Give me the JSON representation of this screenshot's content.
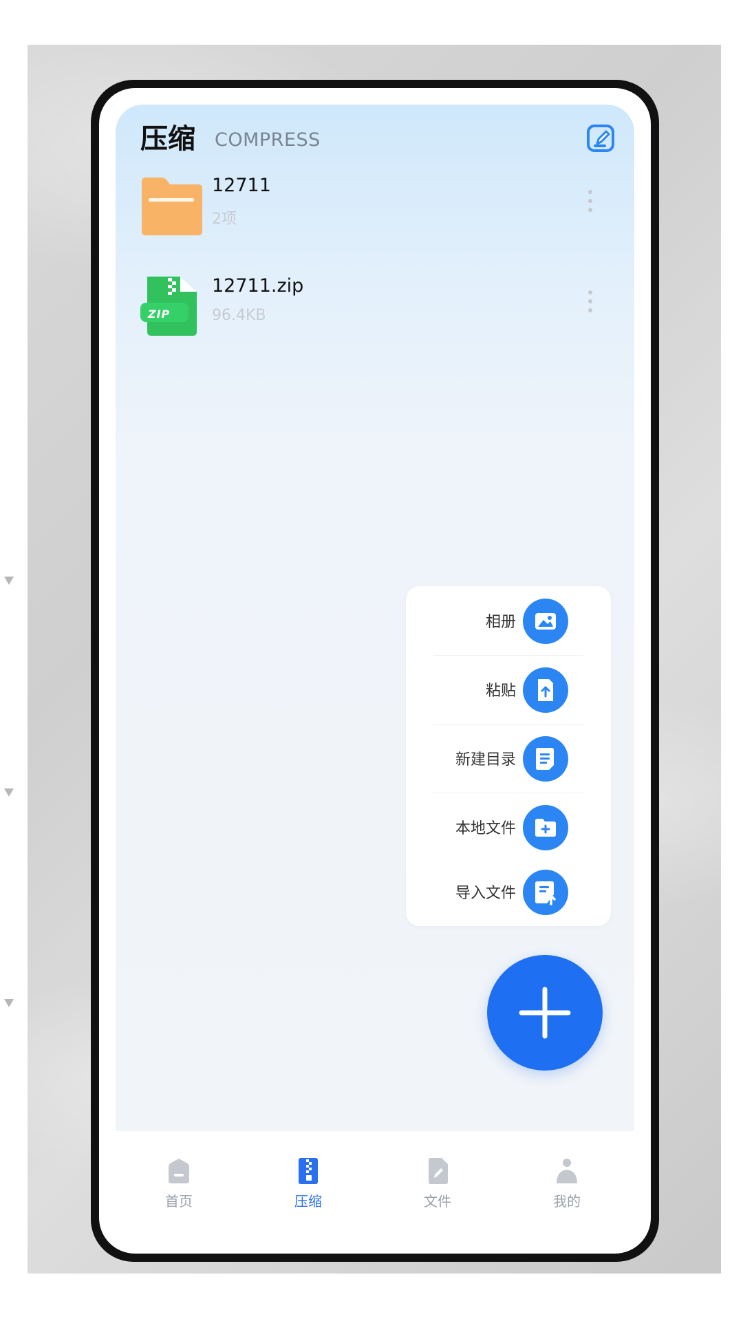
{
  "colors": {
    "accent": "#1f6ff2",
    "menu_icon_bg": "#2b86f4",
    "folder": "#f8b366",
    "zip": "#31c15d",
    "text_muted": "#9aa1aa"
  },
  "header": {
    "title": "压缩",
    "subtitle": "COMPRESS",
    "edit_icon": "edit-icon"
  },
  "files": [
    {
      "name": "12711",
      "meta": "2项",
      "type": "folder",
      "icon": "folder-icon"
    },
    {
      "name": "12711.zip",
      "meta": "96.4KB",
      "type": "zip",
      "icon": "zip-file-icon",
      "badge": "ZIP"
    }
  ],
  "menu": {
    "items": [
      {
        "label": "相册",
        "icon": "album-icon"
      },
      {
        "label": "粘贴",
        "icon": "paste-icon"
      },
      {
        "label": "新建目录",
        "icon": "new-folder-icon"
      },
      {
        "label": "本地文件",
        "icon": "local-file-icon"
      },
      {
        "label": "导入文件",
        "icon": "import-file-icon"
      }
    ]
  },
  "fab": {
    "icon": "plus-icon"
  },
  "bottom_nav": {
    "items": [
      {
        "label": "首页",
        "icon": "home-icon",
        "active": false
      },
      {
        "label": "压缩",
        "icon": "compress-icon",
        "active": true
      },
      {
        "label": "文件",
        "icon": "file-icon",
        "active": false
      },
      {
        "label": "我的",
        "icon": "profile-icon",
        "active": false
      }
    ]
  }
}
